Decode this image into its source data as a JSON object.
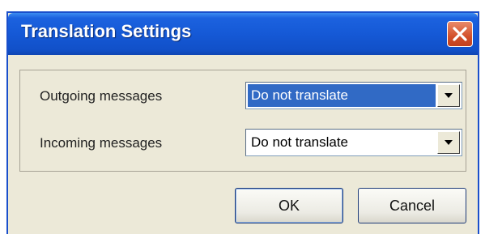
{
  "window": {
    "title": "Translation Settings"
  },
  "rows": [
    {
      "label": "Outgoing messages",
      "value": "Do not translate"
    },
    {
      "label": "Incoming messages",
      "value": "Do not translate"
    }
  ],
  "buttons": {
    "ok": "OK",
    "cancel": "Cancel"
  },
  "colors": {
    "titlebar": "#1559d6",
    "close": "#d3502a",
    "selection": "#316ac5",
    "dialog_bg": "#ece9d8"
  }
}
